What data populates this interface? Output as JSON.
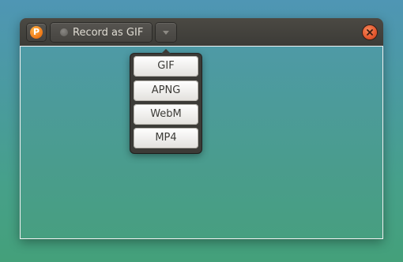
{
  "window": {
    "app_icon": {
      "icon": "peek-logo-icon",
      "glyph": "P"
    },
    "record_button": {
      "label": "Record as GIF",
      "indicator_icon": "record-dot-icon"
    },
    "format_toggle": {
      "icon": "chevron-down-icon"
    },
    "close_button": {
      "icon": "close-icon"
    }
  },
  "format_menu": {
    "items": [
      {
        "label": "GIF"
      },
      {
        "label": "APNG"
      },
      {
        "label": "WebM"
      },
      {
        "label": "MP4"
      }
    ]
  },
  "colors": {
    "titlebar": "#3c3b37",
    "close_button": "#e4572e",
    "logo": "#f07c1a",
    "menu_item": "#efeeec",
    "capture_border": "#f2f2f2",
    "desktop_top": "#4f96b4",
    "desktop_bottom": "#44a07a"
  }
}
